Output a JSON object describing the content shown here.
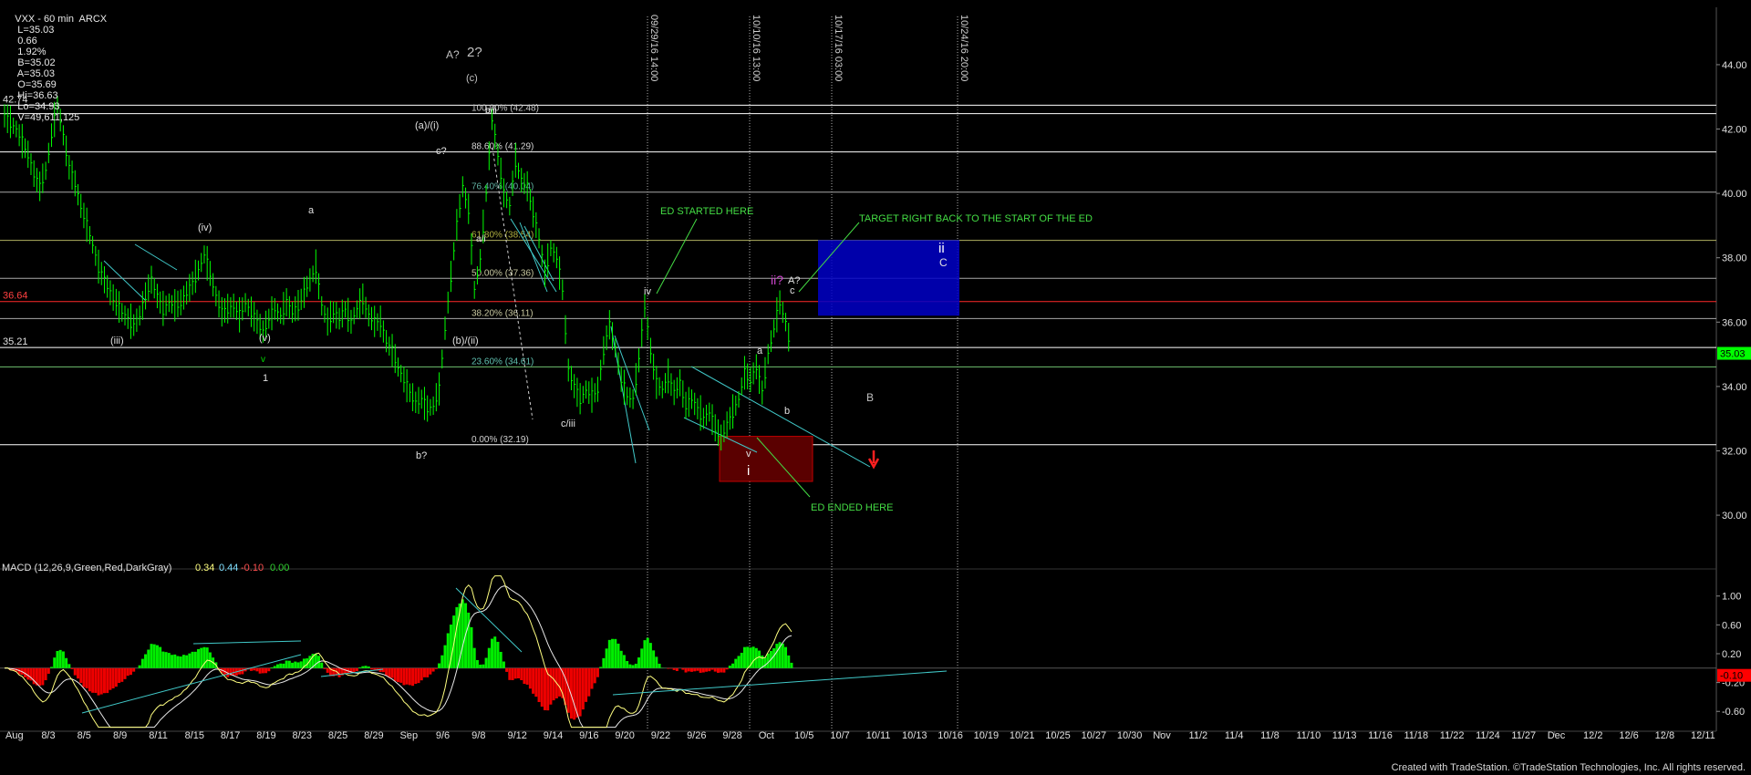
{
  "header": {
    "symbol": "VXX - 60 min  ARCX",
    "last": "L=35.03",
    "change": "0.66",
    "pct": "1.92%",
    "bid": "B=35.02",
    "ask": "A=35.03",
    "open": "O=35.69",
    "high": "Hi=36.63",
    "low": "Lo=34.93",
    "volume": "V=49,611,125"
  },
  "credit": "Created with TradeStation. ©TradeStation Technologies, Inc. All rights reserved.",
  "colors": {
    "background": "#000000",
    "price_bars": "#00ff00",
    "white_lines": "#ffffff",
    "red_line": "#ff2a2a",
    "fib_gray": "#a8a8a8",
    "fib_green": "#70c070",
    "fib_olive": "#b0b060",
    "teal_lines": "#40c8c8",
    "blue_box": "#0000c8",
    "dark_red_box": "#5a0000",
    "annotation_green": "#44dd44",
    "macd_line": "#ffff80",
    "signal_line": "#e8e8e8",
    "hist_pos": "#00ee00",
    "hist_neg": "#ee0000"
  },
  "chart_data": [
    {
      "type": "line",
      "panel": "price",
      "ylim": [
        28.5,
        45.5
      ],
      "ytick_labels": [
        "30.00",
        "32.00",
        "34.00",
        "36.00",
        "38.00",
        "40.00",
        "42.00",
        "44.00"
      ],
      "ytick_values": [
        30,
        32,
        34,
        36,
        38,
        40,
        42,
        44
      ],
      "x_labels": [
        "Aug",
        "8/3",
        "8/5",
        "8/9",
        "8/11",
        "8/15",
        "8/17",
        "8/19",
        "8/23",
        "8/25",
        "8/29",
        "Sep",
        "9/6",
        "9/8",
        "9/12",
        "9/14",
        "9/16",
        "9/20",
        "9/22",
        "9/26",
        "9/28",
        "Oct",
        "10/5",
        "10/7",
        "10/11",
        "10/13",
        "10/16",
        "10/19",
        "10/21",
        "10/25",
        "10/27",
        "10/30",
        "Nov",
        "11/2",
        "11/4",
        "11/8",
        "11/10",
        "11/13",
        "11/16",
        "11/18",
        "11/22",
        "11/24",
        "11/27",
        "Dec",
        "12/2",
        "12/6",
        "12/8",
        "12/11"
      ],
      "price_path": [
        [
          0,
          42.4
        ],
        [
          4,
          42.0
        ],
        [
          8,
          41.2
        ],
        [
          10,
          40.6
        ],
        [
          12,
          40.2
        ],
        [
          14,
          40.7
        ],
        [
          16,
          41.8
        ],
        [
          18,
          42.74
        ],
        [
          20,
          41.8
        ],
        [
          22,
          40.8
        ],
        [
          24,
          40.3
        ],
        [
          26,
          39.6
        ],
        [
          28,
          39.0
        ],
        [
          30,
          38.4
        ],
        [
          32,
          37.7
        ],
        [
          34,
          37.3
        ],
        [
          36,
          36.9
        ],
        [
          38,
          36.6
        ],
        [
          40,
          36.3
        ],
        [
          42,
          36.1
        ],
        [
          44,
          35.9
        ],
        [
          46,
          36.2
        ],
        [
          48,
          36.8
        ],
        [
          50,
          37.3
        ],
        [
          52,
          36.8
        ],
        [
          54,
          36.4
        ],
        [
          56,
          36.6
        ],
        [
          58,
          36.5
        ],
        [
          60,
          36.6
        ],
        [
          62,
          36.9
        ],
        [
          64,
          37.2
        ],
        [
          66,
          37.6
        ],
        [
          68,
          38.1
        ],
        [
          70,
          37.5
        ],
        [
          72,
          36.8
        ],
        [
          74,
          36.3
        ],
        [
          76,
          36.4
        ],
        [
          78,
          36.5
        ],
        [
          80,
          36.2
        ],
        [
          82,
          36.6
        ],
        [
          84,
          36.3
        ],
        [
          86,
          36.0
        ],
        [
          88,
          35.7
        ],
        [
          90,
          36.1
        ],
        [
          92,
          36.4
        ],
        [
          94,
          36.2
        ],
        [
          96,
          36.6
        ],
        [
          98,
          36.3
        ],
        [
          100,
          36.5
        ],
        [
          102,
          36.9
        ],
        [
          104,
          37.3
        ],
        [
          106,
          37.7
        ],
        [
          108,
          36.5
        ],
        [
          110,
          36.0
        ],
        [
          112,
          36.3
        ],
        [
          114,
          36.1
        ],
        [
          116,
          36.4
        ],
        [
          118,
          36.0
        ],
        [
          120,
          36.4
        ],
        [
          122,
          36.7
        ],
        [
          124,
          36.2
        ],
        [
          126,
          36.0
        ],
        [
          128,
          36.0
        ],
        [
          130,
          35.4
        ],
        [
          132,
          35.1
        ],
        [
          134,
          34.6
        ],
        [
          136,
          34.2
        ],
        [
          138,
          33.8
        ],
        [
          140,
          33.5
        ],
        [
          142,
          33.6
        ],
        [
          144,
          33.3
        ],
        [
          146,
          33.4
        ],
        [
          148,
          33.9
        ],
        [
          150,
          35.8
        ],
        [
          152,
          37.4
        ],
        [
          154,
          39.0
        ],
        [
          156,
          40.2
        ],
        [
          158,
          39.5
        ],
        [
          160,
          37.0
        ],
        [
          162,
          37.9
        ],
        [
          164,
          40.0
        ],
        [
          166,
          42.3
        ],
        [
          168,
          41.2
        ],
        [
          170,
          40.0
        ],
        [
          172,
          39.6
        ],
        [
          174,
          41.0
        ],
        [
          176,
          40.4
        ],
        [
          178,
          40.2
        ],
        [
          180,
          39.4
        ],
        [
          182,
          38.6
        ],
        [
          184,
          37.5
        ],
        [
          186,
          38.3
        ],
        [
          188,
          38.0
        ],
        [
          190,
          37.0
        ],
        [
          192,
          34.5
        ],
        [
          194,
          34.0
        ],
        [
          196,
          33.6
        ],
        [
          198,
          33.9
        ],
        [
          200,
          33.7
        ],
        [
          202,
          33.9
        ],
        [
          204,
          35.1
        ],
        [
          206,
          35.9
        ],
        [
          208,
          35.2
        ],
        [
          210,
          34.2
        ],
        [
          212,
          33.7
        ],
        [
          214,
          33.6
        ],
        [
          216,
          34.8
        ],
        [
          218,
          36.5
        ],
        [
          220,
          35.1
        ],
        [
          222,
          34.1
        ],
        [
          224,
          33.9
        ],
        [
          226,
          34.3
        ],
        [
          228,
          33.8
        ],
        [
          230,
          34.1
        ],
        [
          232,
          33.4
        ],
        [
          234,
          33.6
        ],
        [
          236,
          33.3
        ],
        [
          238,
          33.0
        ],
        [
          240,
          33.2
        ],
        [
          242,
          32.7
        ],
        [
          244,
          32.4
        ],
        [
          246,
          32.8
        ],
        [
          248,
          33.2
        ],
        [
          250,
          33.6
        ],
        [
          252,
          34.4
        ],
        [
          254,
          34.2
        ],
        [
          256,
          34.6
        ],
        [
          258,
          33.8
        ],
        [
          260,
          35.0
        ],
        [
          262,
          35.8
        ],
        [
          264,
          36.6
        ],
        [
          266,
          36.0
        ],
        [
          268,
          35.03
        ]
      ],
      "horizontal_levels": [
        {
          "value": 42.74,
          "label": "42.74",
          "color": "white"
        },
        {
          "value": 42.48,
          "label": "",
          "color": "white"
        },
        {
          "value": 41.29,
          "label": "",
          "color": "white"
        },
        {
          "value": 40.04,
          "label": "",
          "color": "fib_gray"
        },
        {
          "value": 38.54,
          "label": "",
          "color": "fib_olive"
        },
        {
          "value": 37.36,
          "label": "",
          "color": "fib_gray"
        },
        {
          "value": 36.64,
          "label": "36.64",
          "color": "red"
        },
        {
          "value": 36.11,
          "label": "",
          "color": "fib_gray"
        },
        {
          "value": 35.21,
          "label": "35.21",
          "color": "white"
        },
        {
          "value": 34.61,
          "label": "",
          "color": "fib_green"
        },
        {
          "value": 32.19,
          "label": "",
          "color": "white"
        }
      ],
      "fib_labels": [
        {
          "text": "100.00% (42.48)",
          "value": 42.48
        },
        {
          "text": "88.60% (41.29)",
          "value": 41.29
        },
        {
          "text": "76.40% (40.04)",
          "value": 40.04
        },
        {
          "text": "61.80% (38.54)",
          "value": 38.54
        },
        {
          "text": "50.00% (37.36)",
          "value": 37.36
        },
        {
          "text": "38.20% (36.11)",
          "value": 36.11
        },
        {
          "text": "23.60% (34.61)",
          "value": 34.61
        },
        {
          "text": "0.00% (32.19)",
          "value": 32.19
        }
      ],
      "last_price_tag": "35.03",
      "vertical_markers": [
        "09/29/16 14:00",
        "10/10/16 13:00",
        "10/17/16 03:00",
        "10/24/16 20:00"
      ],
      "wave_labels": [
        "A?",
        "2?",
        "(c)",
        "b/ii",
        "(a)/(i)",
        "c?",
        "a/i",
        "(iv)",
        "a",
        "(iii)",
        "(v)",
        "v",
        "1",
        "(b)/(ii)",
        "b?",
        "c/iii",
        "iv",
        "a",
        "b",
        "c",
        "A?",
        "ii?",
        "v",
        "i",
        "ii",
        "C",
        "B"
      ],
      "annotations": [
        "ED STARTED HERE",
        "TARGET RIGHT BACK TO THE START OF THE ED",
        "ED ENDED HERE"
      ]
    },
    {
      "type": "line",
      "panel": "macd",
      "title": "MACD (12,26,9,Green,Red,DarkGray)",
      "readouts": [
        "0.34",
        "0.44",
        "-0.10",
        "0.00"
      ],
      "ylim": [
        -0.85,
        1.3
      ],
      "ytick_labels": [
        "-0.60",
        "-0.20",
        "0.20",
        "0.60",
        "1.00"
      ],
      "ytick_values": [
        -0.6,
        -0.2,
        0.2,
        0.6,
        1.0
      ],
      "last_value_tag": "-0.10"
    }
  ]
}
